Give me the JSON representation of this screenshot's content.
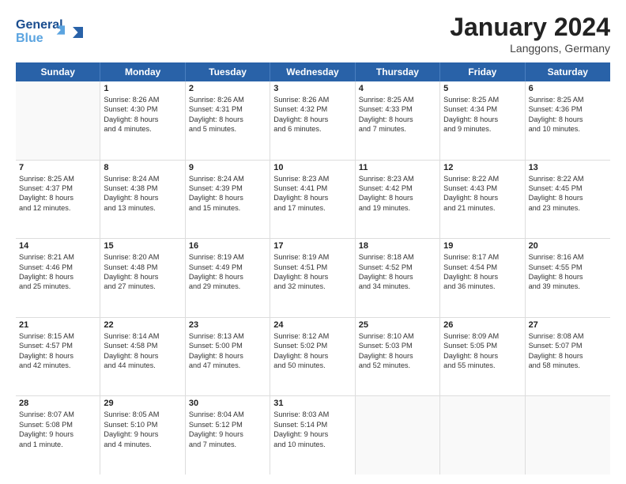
{
  "header": {
    "logo_line1": "General",
    "logo_line2": "Blue",
    "month": "January 2024",
    "location": "Langgons, Germany"
  },
  "weekdays": [
    "Sunday",
    "Monday",
    "Tuesday",
    "Wednesday",
    "Thursday",
    "Friday",
    "Saturday"
  ],
  "weeks": [
    [
      {
        "day": "",
        "lines": []
      },
      {
        "day": "1",
        "lines": [
          "Sunrise: 8:26 AM",
          "Sunset: 4:30 PM",
          "Daylight: 8 hours",
          "and 4 minutes."
        ]
      },
      {
        "day": "2",
        "lines": [
          "Sunrise: 8:26 AM",
          "Sunset: 4:31 PM",
          "Daylight: 8 hours",
          "and 5 minutes."
        ]
      },
      {
        "day": "3",
        "lines": [
          "Sunrise: 8:26 AM",
          "Sunset: 4:32 PM",
          "Daylight: 8 hours",
          "and 6 minutes."
        ]
      },
      {
        "day": "4",
        "lines": [
          "Sunrise: 8:25 AM",
          "Sunset: 4:33 PM",
          "Daylight: 8 hours",
          "and 7 minutes."
        ]
      },
      {
        "day": "5",
        "lines": [
          "Sunrise: 8:25 AM",
          "Sunset: 4:34 PM",
          "Daylight: 8 hours",
          "and 9 minutes."
        ]
      },
      {
        "day": "6",
        "lines": [
          "Sunrise: 8:25 AM",
          "Sunset: 4:36 PM",
          "Daylight: 8 hours",
          "and 10 minutes."
        ]
      }
    ],
    [
      {
        "day": "7",
        "lines": [
          "Sunrise: 8:25 AM",
          "Sunset: 4:37 PM",
          "Daylight: 8 hours",
          "and 12 minutes."
        ]
      },
      {
        "day": "8",
        "lines": [
          "Sunrise: 8:24 AM",
          "Sunset: 4:38 PM",
          "Daylight: 8 hours",
          "and 13 minutes."
        ]
      },
      {
        "day": "9",
        "lines": [
          "Sunrise: 8:24 AM",
          "Sunset: 4:39 PM",
          "Daylight: 8 hours",
          "and 15 minutes."
        ]
      },
      {
        "day": "10",
        "lines": [
          "Sunrise: 8:23 AM",
          "Sunset: 4:41 PM",
          "Daylight: 8 hours",
          "and 17 minutes."
        ]
      },
      {
        "day": "11",
        "lines": [
          "Sunrise: 8:23 AM",
          "Sunset: 4:42 PM",
          "Daylight: 8 hours",
          "and 19 minutes."
        ]
      },
      {
        "day": "12",
        "lines": [
          "Sunrise: 8:22 AM",
          "Sunset: 4:43 PM",
          "Daylight: 8 hours",
          "and 21 minutes."
        ]
      },
      {
        "day": "13",
        "lines": [
          "Sunrise: 8:22 AM",
          "Sunset: 4:45 PM",
          "Daylight: 8 hours",
          "and 23 minutes."
        ]
      }
    ],
    [
      {
        "day": "14",
        "lines": [
          "Sunrise: 8:21 AM",
          "Sunset: 4:46 PM",
          "Daylight: 8 hours",
          "and 25 minutes."
        ]
      },
      {
        "day": "15",
        "lines": [
          "Sunrise: 8:20 AM",
          "Sunset: 4:48 PM",
          "Daylight: 8 hours",
          "and 27 minutes."
        ]
      },
      {
        "day": "16",
        "lines": [
          "Sunrise: 8:19 AM",
          "Sunset: 4:49 PM",
          "Daylight: 8 hours",
          "and 29 minutes."
        ]
      },
      {
        "day": "17",
        "lines": [
          "Sunrise: 8:19 AM",
          "Sunset: 4:51 PM",
          "Daylight: 8 hours",
          "and 32 minutes."
        ]
      },
      {
        "day": "18",
        "lines": [
          "Sunrise: 8:18 AM",
          "Sunset: 4:52 PM",
          "Daylight: 8 hours",
          "and 34 minutes."
        ]
      },
      {
        "day": "19",
        "lines": [
          "Sunrise: 8:17 AM",
          "Sunset: 4:54 PM",
          "Daylight: 8 hours",
          "and 36 minutes."
        ]
      },
      {
        "day": "20",
        "lines": [
          "Sunrise: 8:16 AM",
          "Sunset: 4:55 PM",
          "Daylight: 8 hours",
          "and 39 minutes."
        ]
      }
    ],
    [
      {
        "day": "21",
        "lines": [
          "Sunrise: 8:15 AM",
          "Sunset: 4:57 PM",
          "Daylight: 8 hours",
          "and 42 minutes."
        ]
      },
      {
        "day": "22",
        "lines": [
          "Sunrise: 8:14 AM",
          "Sunset: 4:58 PM",
          "Daylight: 8 hours",
          "and 44 minutes."
        ]
      },
      {
        "day": "23",
        "lines": [
          "Sunrise: 8:13 AM",
          "Sunset: 5:00 PM",
          "Daylight: 8 hours",
          "and 47 minutes."
        ]
      },
      {
        "day": "24",
        "lines": [
          "Sunrise: 8:12 AM",
          "Sunset: 5:02 PM",
          "Daylight: 8 hours",
          "and 50 minutes."
        ]
      },
      {
        "day": "25",
        "lines": [
          "Sunrise: 8:10 AM",
          "Sunset: 5:03 PM",
          "Daylight: 8 hours",
          "and 52 minutes."
        ]
      },
      {
        "day": "26",
        "lines": [
          "Sunrise: 8:09 AM",
          "Sunset: 5:05 PM",
          "Daylight: 8 hours",
          "and 55 minutes."
        ]
      },
      {
        "day": "27",
        "lines": [
          "Sunrise: 8:08 AM",
          "Sunset: 5:07 PM",
          "Daylight: 8 hours",
          "and 58 minutes."
        ]
      }
    ],
    [
      {
        "day": "28",
        "lines": [
          "Sunrise: 8:07 AM",
          "Sunset: 5:08 PM",
          "Daylight: 9 hours",
          "and 1 minute."
        ]
      },
      {
        "day": "29",
        "lines": [
          "Sunrise: 8:05 AM",
          "Sunset: 5:10 PM",
          "Daylight: 9 hours",
          "and 4 minutes."
        ]
      },
      {
        "day": "30",
        "lines": [
          "Sunrise: 8:04 AM",
          "Sunset: 5:12 PM",
          "Daylight: 9 hours",
          "and 7 minutes."
        ]
      },
      {
        "day": "31",
        "lines": [
          "Sunrise: 8:03 AM",
          "Sunset: 5:14 PM",
          "Daylight: 9 hours",
          "and 10 minutes."
        ]
      },
      {
        "day": "",
        "lines": []
      },
      {
        "day": "",
        "lines": []
      },
      {
        "day": "",
        "lines": []
      }
    ]
  ]
}
